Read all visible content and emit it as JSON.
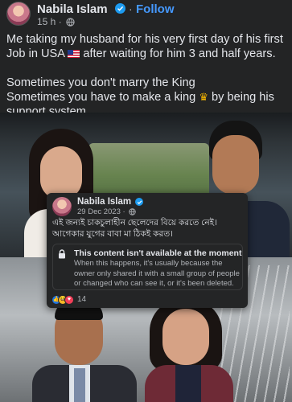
{
  "post": {
    "author": "Nabila Islam",
    "follow_label": "Follow",
    "separator": "·",
    "time": "15 h ·",
    "caption_line1": "Me taking my husband for his very first day of his first Job in USA",
    "caption_line1b": "after waiting for him 3 and half years.",
    "caption_line2": "Sometimes you don't marry the King",
    "caption_line3": "Sometimes you have to make a king",
    "caption_line3b": "by being his support system.",
    "icons": [
      "verified-badge-icon",
      "globe-icon",
      "us-flag-emoji",
      "crown-emoji"
    ],
    "accent_color": "#4599ff"
  },
  "shared_post": {
    "author": "Nabila Islam",
    "date": "29 Dec 2023 ·",
    "text": "এই জন্যই চাকচুলাহীন ছেলেদের বিয়ে করতে নেই।আগেকার যুগের বাবা মা ঠিকই করত।",
    "unavailable_title": "This content isn't available at the moment",
    "unavailable_body": "When this happens, it's usually because the owner only shared it with a small group of people or changed who can see it, or it's been deleted.",
    "reaction_count": "14",
    "reaction_icons": [
      "like-icon",
      "haha-icon",
      "love-icon"
    ]
  }
}
